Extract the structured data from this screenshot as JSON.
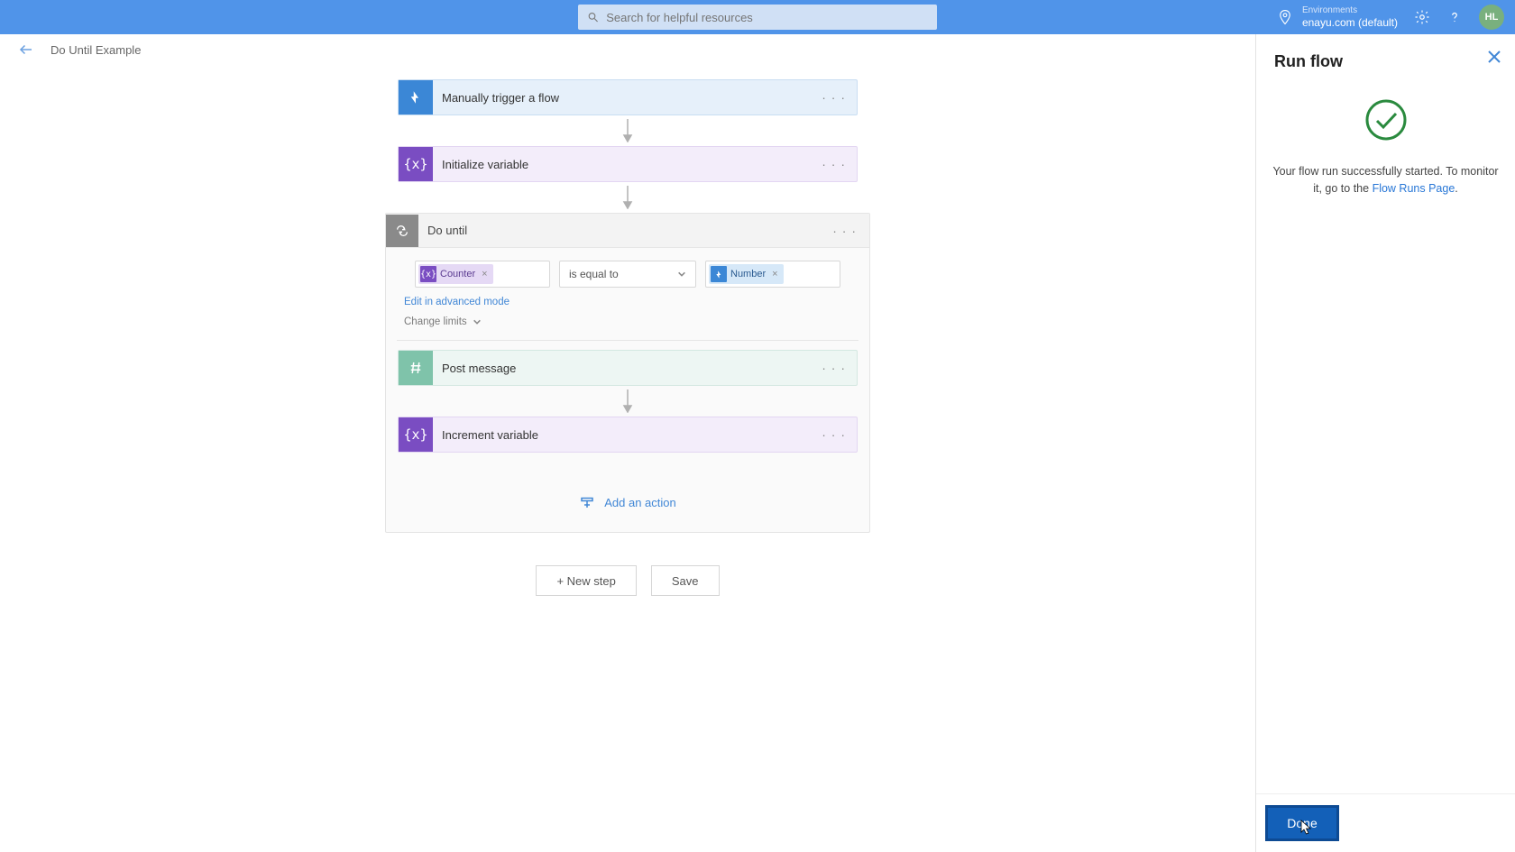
{
  "topbar": {
    "search_placeholder": "Search for helpful resources",
    "env_label": "Environments",
    "env_name": "enayu.com (default)",
    "avatar_initials": "HL"
  },
  "breadcrumb": {
    "title": "Do Until Example"
  },
  "flow": {
    "trigger": {
      "title": "Manually trigger a flow"
    },
    "init_var": {
      "title": "Initialize variable"
    },
    "do_until": {
      "title": "Do until",
      "left_token": "Counter",
      "operator": "is equal to",
      "right_token": "Number",
      "edit_advanced": "Edit in advanced mode",
      "change_limits": "Change limits",
      "post_message": {
        "title": "Post message"
      },
      "increment": {
        "title": "Increment variable"
      },
      "add_action": "Add an action"
    },
    "new_step": "+ New step",
    "save": "Save"
  },
  "panel": {
    "title": "Run flow",
    "message_before": "Your flow run successfully started. To monitor it, go to the ",
    "link_text": "Flow Runs Page",
    "message_after": ".",
    "done": "Done"
  }
}
